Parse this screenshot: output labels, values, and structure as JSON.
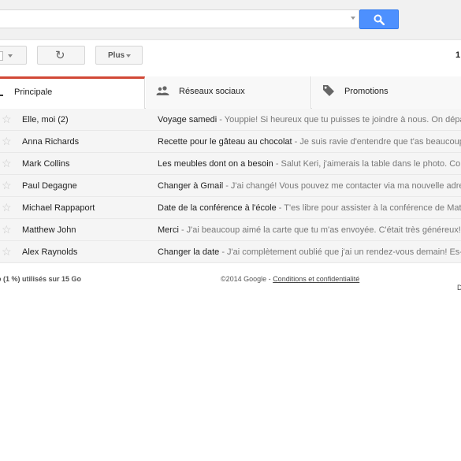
{
  "search": {
    "placeholder": ""
  },
  "toolbar": {
    "refresh_symbol": "↻",
    "more_label": "Plus",
    "count": "1"
  },
  "tabs": [
    {
      "label": "Principale"
    },
    {
      "label": "Réseaux sociaux"
    },
    {
      "label": "Promotions"
    }
  ],
  "emails": [
    {
      "sender": "Elle, moi (2)",
      "subject": "Voyage samedi",
      "snippet": " - Youppie! Si heureux que tu puisses te joindre à nous. On dépa"
    },
    {
      "sender": "Anna Richards",
      "subject": "Recette pour le gâteau au chocolat",
      "snippet": " - Je suis ravie d'entendre que t'as beaucoup"
    },
    {
      "sender": "Mark Collins",
      "subject": "Les meubles dont on a besoin",
      "snippet": " - Salut Keri, j'aimerais la table dans le photo. Con"
    },
    {
      "sender": "Paul Degagne",
      "subject": "Changer à Gmail",
      "snippet": " - J'ai changé! Vous pouvez me contacter via ma nouvelle adre"
    },
    {
      "sender": "Michael Rappaport",
      "subject": "Date de la conférence à l'école",
      "snippet": " - T'es libre pour assister à la conférence de Matt"
    },
    {
      "sender": "Matthew John",
      "subject": "Merci",
      "snippet": " - J'ai beaucoup aimé la carte que tu m'as envoyée. C'était très généreux!"
    },
    {
      "sender": "Alex Raynolds",
      "subject": "Changer la date",
      "snippet": " - J'ai complètement oublié que j'ai un rendez-vous demain! Es-c"
    }
  ],
  "footer": {
    "quota": "o (1 %) utilisés sur 15 Go",
    "copyright": "©2014 Google - ",
    "terms_link": "Conditions et confidentialité",
    "corner": "D"
  },
  "colors": {
    "accent": "#4d90fe",
    "tab_active": "#d14836"
  }
}
